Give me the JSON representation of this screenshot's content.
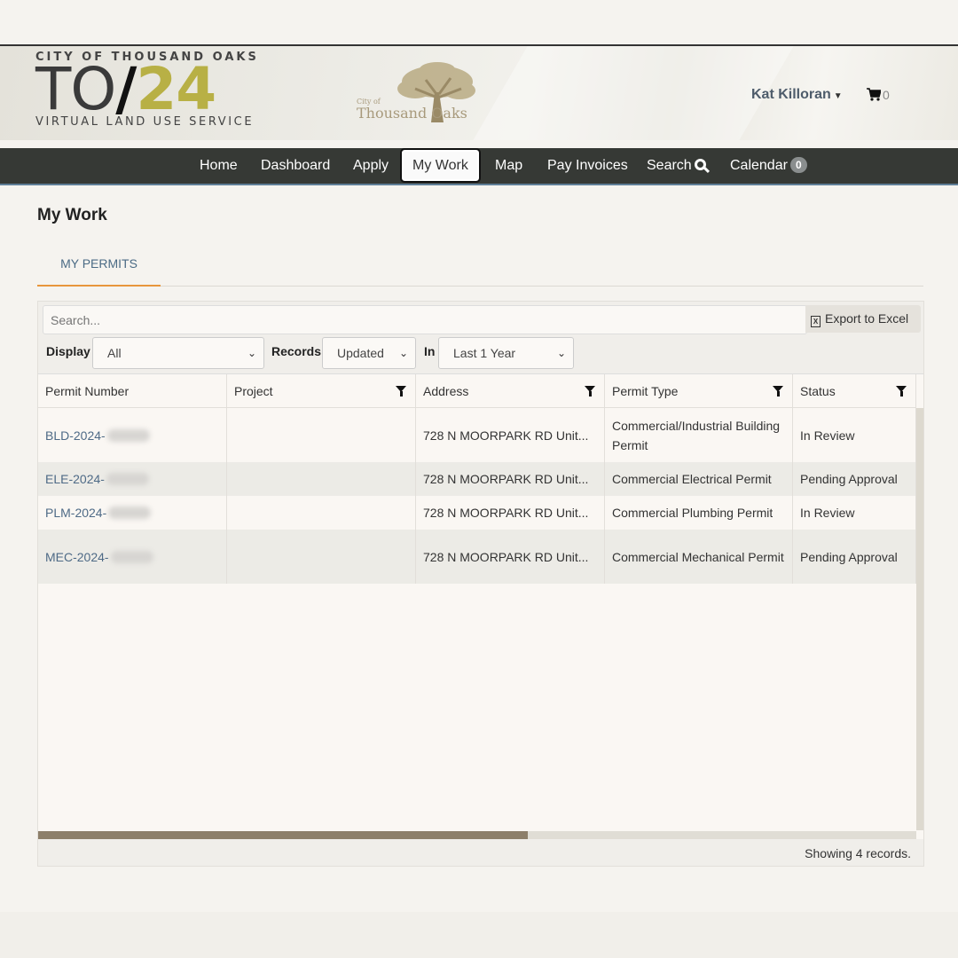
{
  "header": {
    "logo": {
      "city_line": "CITY OF THOUSAND OAKS",
      "big_to": "TO",
      "big_slash": "/",
      "big_year": "24",
      "tagline": "VIRTUAL LAND USE SERVICE"
    },
    "seal": {
      "small": "City of",
      "name": "Thousand Oaks"
    },
    "user_name": "Kat Killoran",
    "cart_count": "0"
  },
  "nav": {
    "items": [
      {
        "label": "Home"
      },
      {
        "label": "Dashboard"
      },
      {
        "label": "Apply"
      },
      {
        "label": "My Work",
        "active": true
      },
      {
        "label": "Map"
      },
      {
        "label": "Pay Invoices"
      },
      {
        "label": "Search"
      },
      {
        "label": "Calendar",
        "badge": "0"
      }
    ]
  },
  "page": {
    "title": "My Work",
    "tabs": [
      {
        "label": "MY PERMITS",
        "active": true
      }
    ]
  },
  "toolbar": {
    "search_placeholder": "Search...",
    "export_label": "Export to Excel",
    "export_icon": "excel-icon",
    "display_label": "Display",
    "display_value": "All",
    "records_label": "Records",
    "records_value": "Updated",
    "in_label": "In",
    "in_value": "Last 1 Year"
  },
  "table": {
    "columns": [
      "Permit Number",
      "Project",
      "Address",
      "Permit Type",
      "Status"
    ],
    "rows": [
      {
        "permit": "BLD-2024-",
        "project": "",
        "address": "728 N MOORPARK RD Unit...",
        "type": "Commercial/Industrial Building Permit",
        "status": "In Review"
      },
      {
        "permit": "ELE-2024-",
        "project": "",
        "address": "728 N MOORPARK RD Unit...",
        "type": "Commercial Electrical Permit",
        "status": "Pending Approval"
      },
      {
        "permit": "PLM-2024-",
        "project": "",
        "address": "728 N MOORPARK RD Unit...",
        "type": "Commercial Plumbing Permit",
        "status": "In Review"
      },
      {
        "permit": "MEC-2024-",
        "project": "",
        "address": "728 N MOORPARK RD Unit...",
        "type": "Commercial Mechanical Permit",
        "status": "Pending Approval"
      }
    ],
    "footer": "Showing 4 records."
  },
  "colors": {
    "nav_bg": "#363935",
    "tab_accent": "#e8963c",
    "link": "#4e6a86",
    "year_accent": "#b8b045"
  }
}
